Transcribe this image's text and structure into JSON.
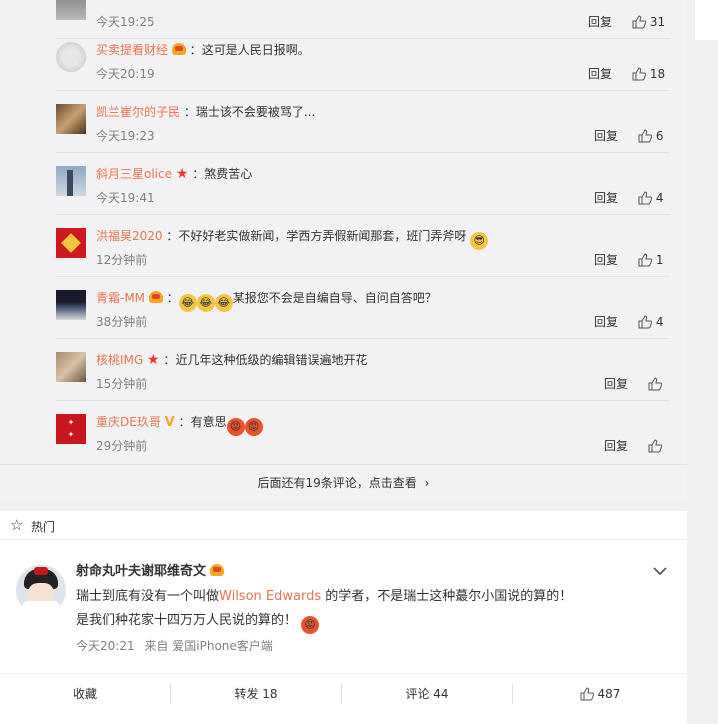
{
  "reply_label": "回复",
  "comments": [
    {
      "user": "",
      "text": "",
      "time": "今天19:25",
      "likes": "31"
    },
    {
      "user": "买卖提看财经",
      "sep": "：",
      "text": "这可是人民日报啊。",
      "time": "今天20:19",
      "likes": "18",
      "badge": "crown"
    },
    {
      "user": "凯兰崔尔的子民",
      "sep": "：",
      "text": "瑞士该不会要被骂了...",
      "time": "今天19:23",
      "likes": "6"
    },
    {
      "user": "斜月三星olice",
      "sep": "：",
      "text": "煞费苦心",
      "time": "今天19:41",
      "likes": "4",
      "badge": "star"
    },
    {
      "user": "洪福昊2020",
      "sep": "：",
      "text": "不好好老实做新闻，学西方弄假新闻那套，班门弄斧呀",
      "time": "12分钟前",
      "likes": "1"
    },
    {
      "user": "青霜-MM",
      "sep": "：",
      "text": "某报您不会是自编自导、自问自答吧？",
      "time": "38分钟前",
      "likes": "4",
      "badge": "crown"
    },
    {
      "user": "核桃IMG",
      "sep": "：",
      "text": "近几年这种低级的编辑错误遍地开花",
      "time": "15分钟前",
      "likes": "",
      "badge": "star"
    },
    {
      "user": "重庆DE玖哥",
      "sep": "：",
      "text": "有意思",
      "time": "29分钟前",
      "likes": "",
      "badge": "v"
    }
  ],
  "more_comments": "后面还有19条评论，点击查看",
  "hot_label": "热门",
  "post": {
    "author": "射命丸叶夫谢耶维奇文",
    "line1_pre": "瑞士到底有没有一个叫做",
    "line1_link": "Wilson Edwards",
    "line1_post": " 的学者，不是瑞士这种蕞尔小国说的算的！",
    "line2": "是我们种花家十四万万人民说的算的！",
    "time": "今天20:21",
    "source_prefix": "来自",
    "source": "爱国iPhone客户端"
  },
  "actions": {
    "favorite": "收藏",
    "repost": "转发 18",
    "comment": "评论 44",
    "like": "487"
  },
  "colors": {
    "username": "#eb7350",
    "link": "#eb7350",
    "accent": "#f5a623"
  }
}
